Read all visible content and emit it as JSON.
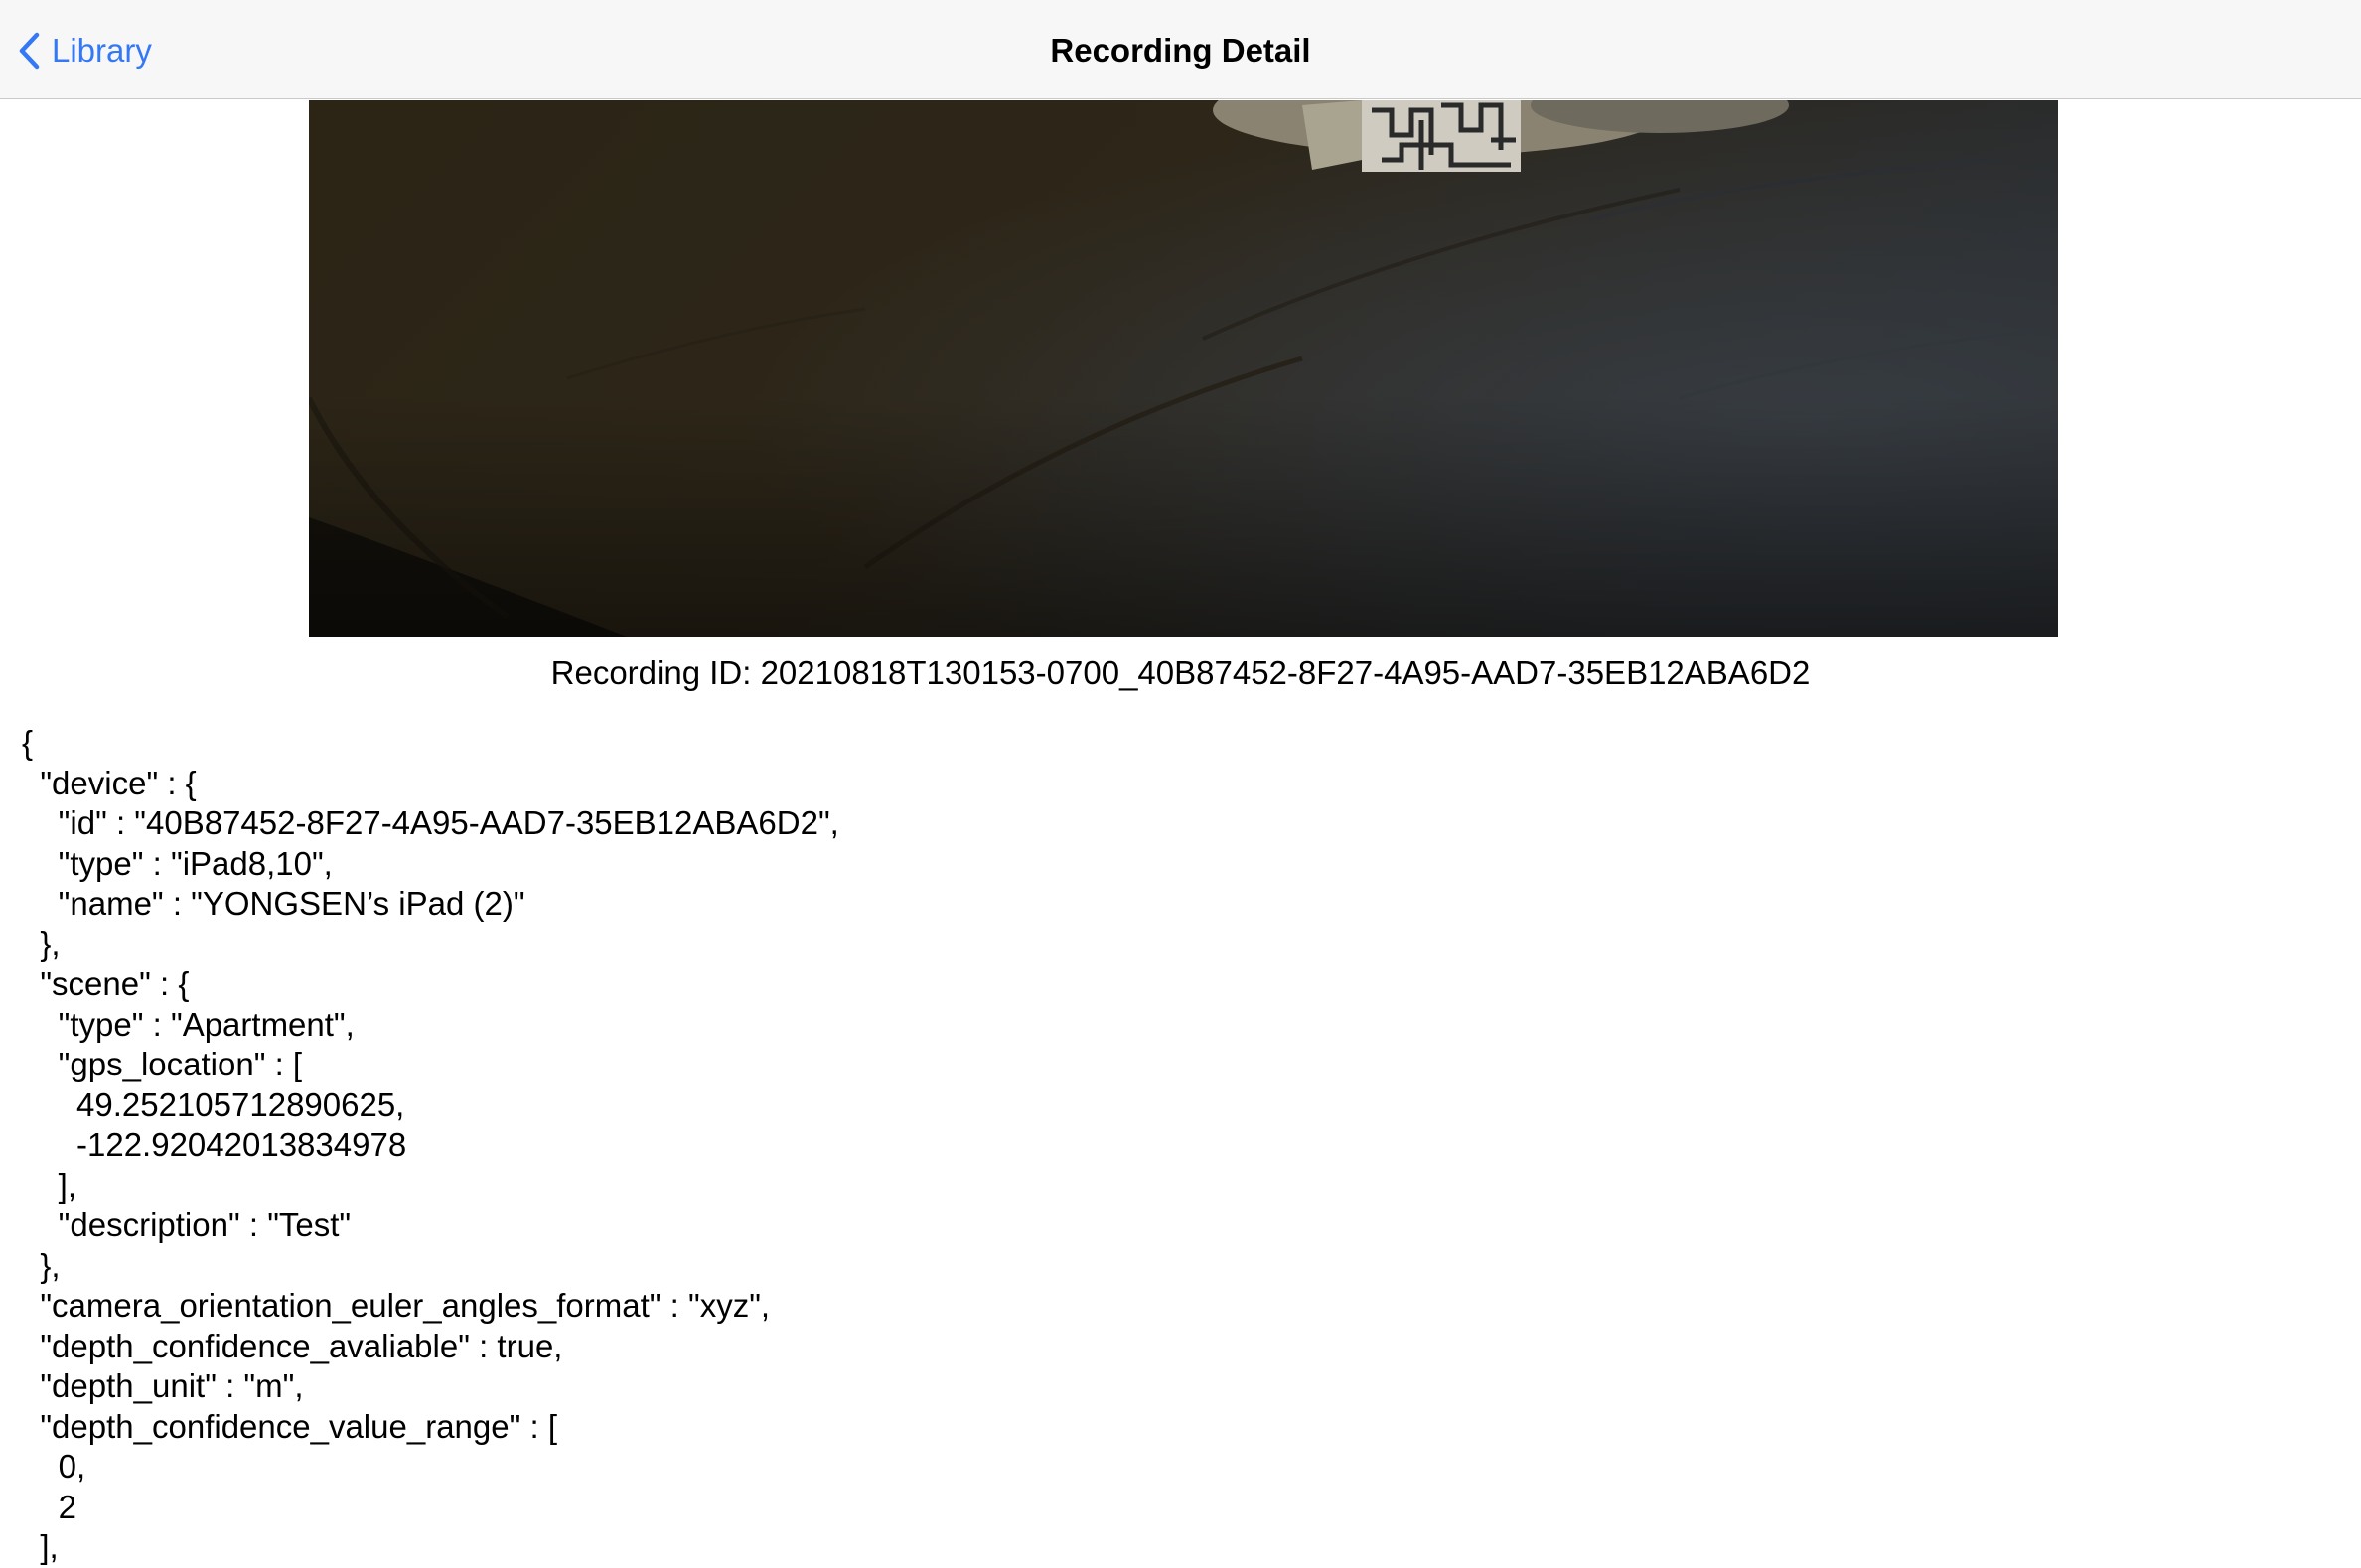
{
  "nav": {
    "back_label": "Library",
    "title": "Recording Detail",
    "back_icon": "chevron-left-icon",
    "accent_color": "#3478f6"
  },
  "media": {
    "kind": "video-thumbnail"
  },
  "recording": {
    "id_line": "Recording ID: 20210818T130153-0700_40B87452-8F27-4A95-AAD7-35EB12ABA6D2"
  },
  "metadata": {
    "lines": [
      "{",
      "  \"device\" : {",
      "    \"id\" : \"40B87452-8F27-4A95-AAD7-35EB12ABA6D2\",",
      "    \"type\" : \"iPad8,10\",",
      "    \"name\" : \"YONGSEN’s iPad (2)\"",
      "  },",
      "  \"scene\" : {",
      "    \"type\" : \"Apartment\",",
      "    \"gps_location\" : [",
      "      49.252105712890625,",
      "      -122.92042013834978",
      "    ],",
      "    \"description\" : \"Test\"",
      "  },",
      "  \"camera_orientation_euler_angles_format\" : \"xyz\",",
      "  \"depth_confidence_avaliable\" : true,",
      "  \"depth_unit\" : \"m\",",
      "  \"depth_confidence_value_range\" : [",
      "    0,",
      "    2",
      "  ],"
    ]
  }
}
